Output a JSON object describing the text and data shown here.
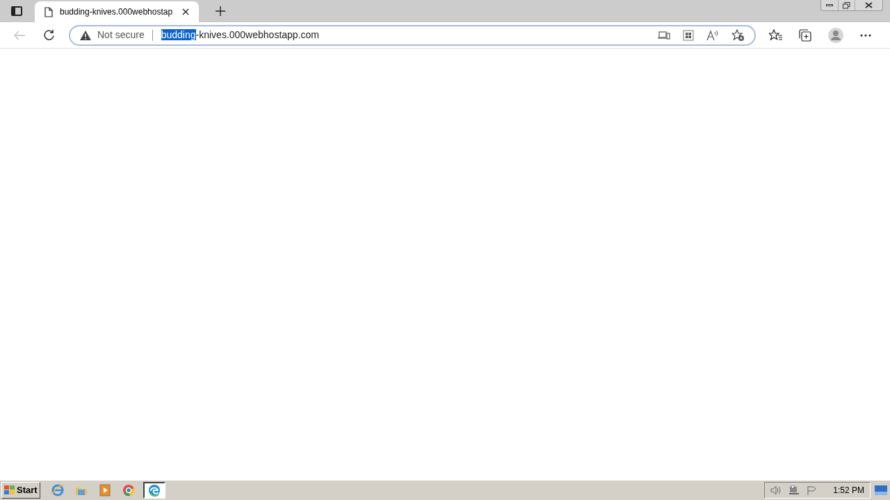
{
  "tab": {
    "title": "budding-knives.000webhostap"
  },
  "address_bar": {
    "security": "Not secure",
    "url_selected": "budding",
    "url_rest": "-knives.000webhostapp.com"
  },
  "taskbar": {
    "start": "Start",
    "apps": [
      {
        "kind": "ie",
        "selected": false
      },
      {
        "kind": "folder",
        "selected": false
      },
      {
        "kind": "media",
        "selected": false
      },
      {
        "kind": "chrome",
        "selected": false
      },
      {
        "kind": "edge",
        "selected": true
      }
    ],
    "clock": "1:52 PM"
  }
}
